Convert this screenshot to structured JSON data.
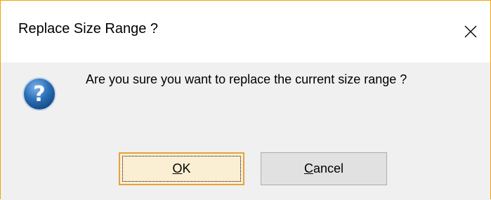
{
  "window": {
    "title": "Replace Size Range ?",
    "close_glyph": "✕"
  },
  "message": {
    "icon": "question-icon",
    "text": "Are you sure you want to replace the current size range ?"
  },
  "buttons": {
    "ok": {
      "mnemonic": "O",
      "rest": "K",
      "default": true
    },
    "cancel": {
      "mnemonic": "C",
      "rest": "ancel"
    }
  },
  "colors": {
    "accent_border": "#f0a30a",
    "icon_blue": "#2b6fb8",
    "default_button_border": "#e6a23c"
  }
}
